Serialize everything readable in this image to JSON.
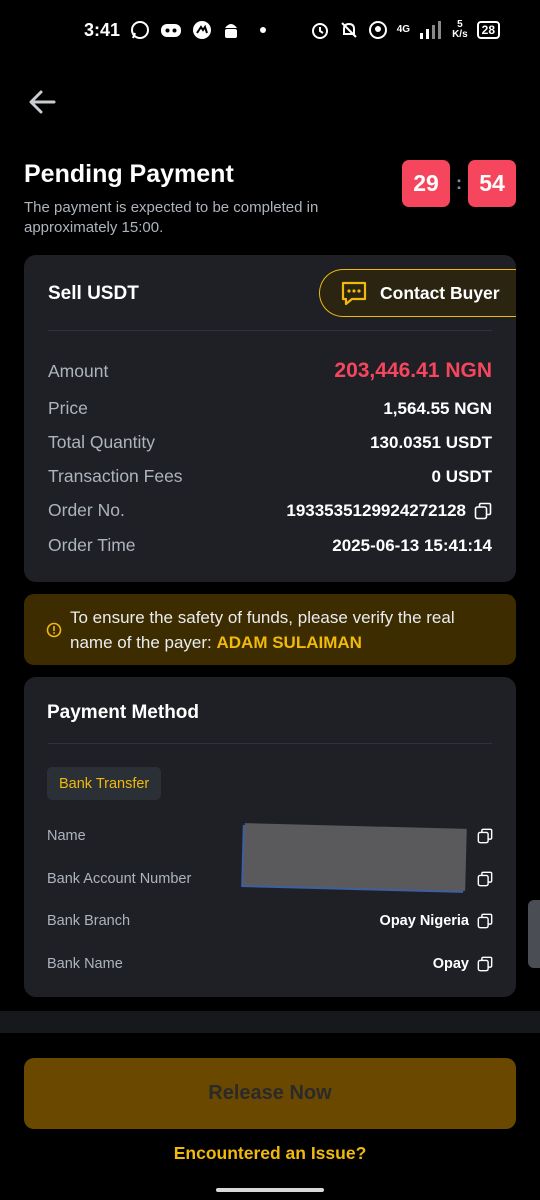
{
  "status_bar": {
    "time": "3:41",
    "network": "4G",
    "net_speed_value": "5",
    "net_speed_unit": "K/s",
    "battery": "28"
  },
  "header": {
    "title": "Pending Payment",
    "subtitle": "The payment is expected to be completed in approximately 15:00.",
    "timer_minutes": "29",
    "timer_seconds": "54",
    "timer_separator": ":"
  },
  "order": {
    "title": "Sell USDT",
    "contact_label": "Contact Buyer",
    "rows": [
      {
        "label": "Amount",
        "value": "203,446.41 NGN"
      },
      {
        "label": "Price",
        "value": "1,564.55 NGN"
      },
      {
        "label": "Total Quantity",
        "value": "130.0351 USDT"
      },
      {
        "label": "Transaction Fees",
        "value": "0 USDT"
      },
      {
        "label": "Order No.",
        "value": "1933535129924272128"
      },
      {
        "label": "Order Time",
        "value": "2025-06-13 15:41:14"
      }
    ]
  },
  "notice": {
    "text": "To ensure the safety of funds, please verify the real name of the payer: ",
    "payer_name": "ADAM SULAIMAN"
  },
  "payment": {
    "title": "Payment Method",
    "method_tag": "Bank Transfer",
    "rows": [
      {
        "label": "Name",
        "value": ""
      },
      {
        "label": "Bank Account Number",
        "value": ""
      },
      {
        "label": "Bank Branch",
        "value": "Opay Nigeria"
      },
      {
        "label": "Bank Name",
        "value": "Opay"
      }
    ]
  },
  "actions": {
    "release_label": "Release Now",
    "issue_label": "Encountered an Issue?"
  },
  "colors": {
    "accent": "#f0b90b",
    "danger": "#f6465d",
    "card_bg": "#1e2026",
    "background": "#000000"
  }
}
